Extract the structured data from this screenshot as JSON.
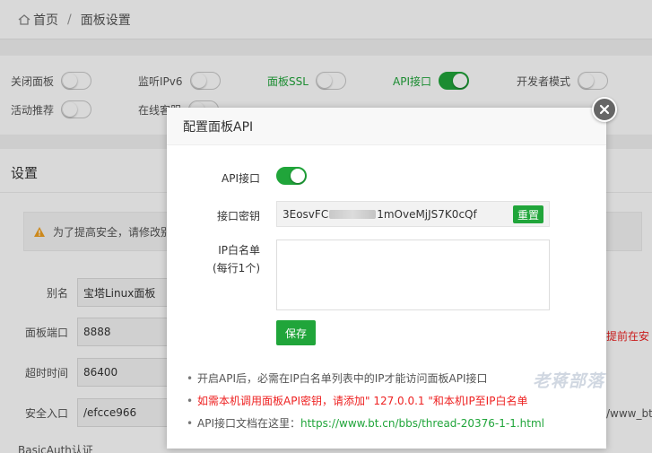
{
  "breadcrumb": {
    "home": "首页",
    "separator": "/",
    "current": "面板设置"
  },
  "switches": [
    {
      "label": "关闭面板",
      "on": false,
      "highlight": false
    },
    {
      "label": "监听IPv6",
      "on": false,
      "highlight": false
    },
    {
      "label": "面板SSL",
      "on": false,
      "highlight": true
    },
    {
      "label": "API接口",
      "on": true,
      "highlight": true
    },
    {
      "label": "开发者模式",
      "on": false,
      "highlight": false
    },
    {
      "label": "活动推荐",
      "on": false,
      "highlight": false
    },
    {
      "label": "在线客服",
      "on": false,
      "highlight": false
    }
  ],
  "settings": {
    "title": "设置",
    "warning": "为了提高安全，请修改别",
    "fields": [
      {
        "label": "别名",
        "value": "宝塔Linux面板"
      },
      {
        "label": "面板端口",
        "value": "8888"
      },
      {
        "label": "超时时间",
        "value": "86400"
      },
      {
        "label": "安全入口",
        "value": "/efcce966"
      }
    ],
    "red_note": "提前在安",
    "right_note": "/www_bt",
    "basic_auth": "BasicAuth认证"
  },
  "modal": {
    "title": "配置面板API",
    "api_label": "API接口",
    "api_on": true,
    "key_label": "接口密钥",
    "key_start": "3EosvFC",
    "key_end": "1mOveMjJS7K0cQf",
    "reset_label": "重置",
    "ip_label_1": "IP白名单",
    "ip_label_2": "(每行1个)",
    "ip_value": "",
    "save_label": "保存",
    "tips": [
      "开启API后，必需在IP白名单列表中的IP才能访问面板API接口",
      "如需本机调用面板API密钥，请添加\" 127.0.0.1 \"和本机IP至IP白名单"
    ],
    "doc_prefix": "API接口文档在这里：",
    "doc_link": "https://www.bt.cn/bbs/thread-20376-1-1.html"
  },
  "watermark": "老蒋部落",
  "colors": {
    "accent": "#20a53a",
    "danger": "#ee2222"
  }
}
